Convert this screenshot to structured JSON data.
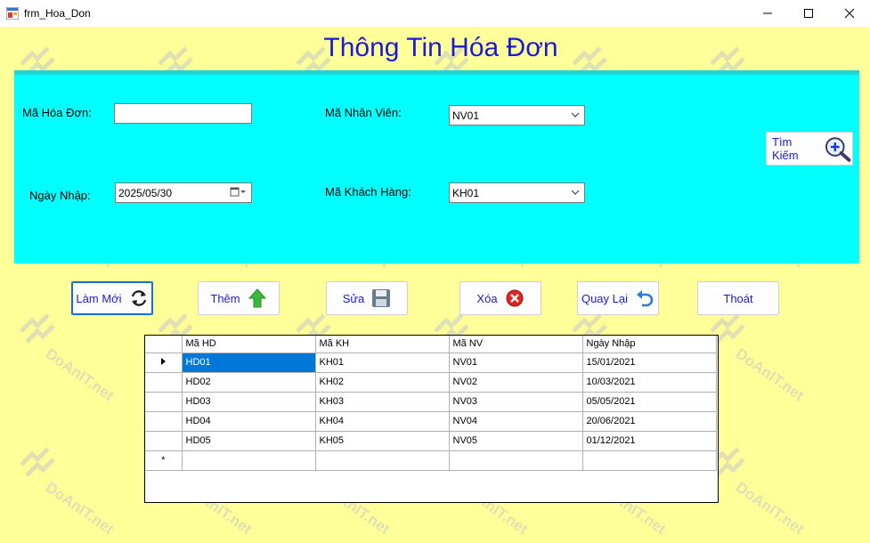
{
  "window": {
    "title": "frm_Hoa_Don"
  },
  "form": {
    "heading": "Thông Tin Hóa Đơn",
    "labels": {
      "invoice_id": "Mã Hóa Đơn:",
      "employee_id": "Mã Nhân Viên:",
      "date": "Ngày Nhập:",
      "customer_id": "Mã Khách Hàng:"
    },
    "fields": {
      "invoice_id": "",
      "employee_id": "NV01",
      "date": "2025/05/30",
      "customer_id": "KH01"
    },
    "search_button": "Tìm Kiếm"
  },
  "buttons": {
    "refresh": "Làm Mới",
    "add": "Thêm",
    "edit": "Sửa",
    "delete": "Xóa",
    "back": "Quay Lại",
    "exit": "Thoát"
  },
  "grid": {
    "columns": [
      "Mã HD",
      "Mã KH",
      "Mã NV",
      "Ngày Nhập"
    ],
    "rows": [
      [
        "HD01",
        "KH01",
        "NV01",
        "15/01/2021"
      ],
      [
        "HD02",
        "KH02",
        "NV02",
        "10/03/2021"
      ],
      [
        "HD03",
        "KH03",
        "NV03",
        "05/05/2021"
      ],
      [
        "HD04",
        "KH04",
        "NV04",
        "20/06/2021"
      ],
      [
        "HD05",
        "KH05",
        "NV05",
        "01/12/2021"
      ]
    ],
    "new_row_marker": "*"
  },
  "watermark": "DoAnIT.net"
}
